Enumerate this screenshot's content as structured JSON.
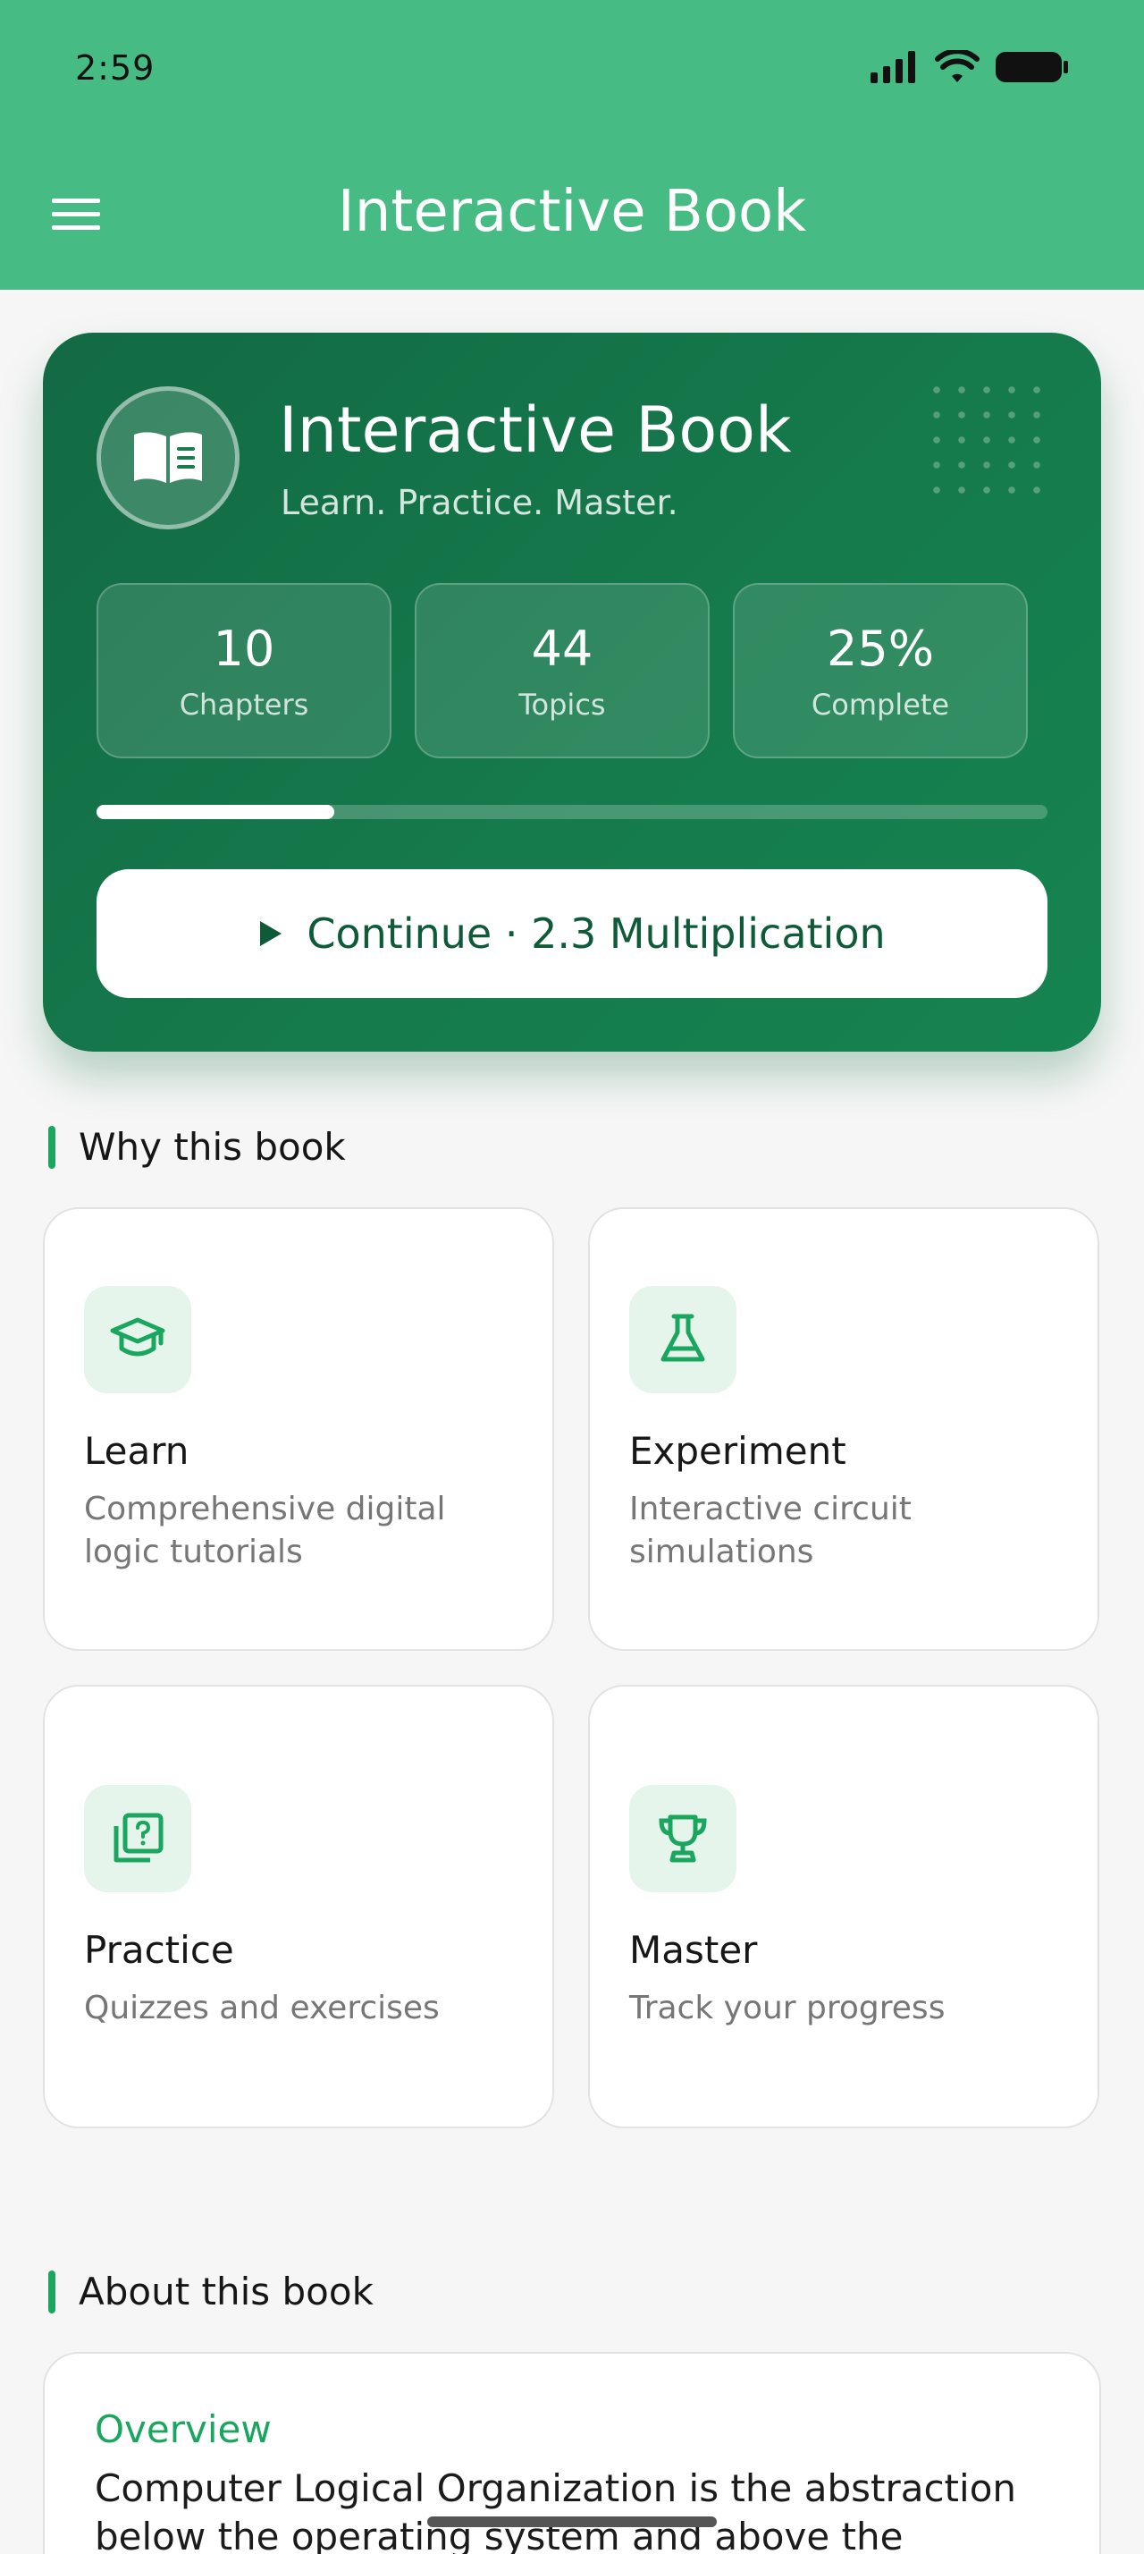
{
  "status_bar": {
    "time": "2:59"
  },
  "app_bar": {
    "title": "Interactive Book"
  },
  "hero": {
    "title": "Interactive Book",
    "subtitle": "Learn. Practice. Master.",
    "stats": [
      {
        "value": "10",
        "label": "Chapters"
      },
      {
        "value": "44",
        "label": "Topics"
      },
      {
        "value": "25%",
        "label": "Complete"
      }
    ],
    "progress_fraction": 0.25,
    "continue_label": "Continue · 2.3 Multiplication"
  },
  "why_section": {
    "title": "Why this book",
    "features": [
      {
        "icon": "graduation-cap-icon",
        "title": "Learn",
        "description": "Comprehensive digital logic tutorials"
      },
      {
        "icon": "flask-icon",
        "title": "Experiment",
        "description": "Interactive circuit simulations"
      },
      {
        "icon": "quiz-icon",
        "title": "Practice",
        "description": "Quizzes and exercises"
      },
      {
        "icon": "trophy-icon",
        "title": "Master",
        "description": "Track your progress"
      }
    ]
  },
  "about_section": {
    "title": "About this book",
    "heading": "Overview",
    "text": "Computer Logical Organization is the abstraction below the operating system and above the"
  },
  "colors": {
    "app_bar": "#46bb84",
    "hero_start": "#126a43",
    "hero_end": "#158450",
    "accent": "#1ba65f",
    "icon_bg": "#e5f5ec"
  }
}
